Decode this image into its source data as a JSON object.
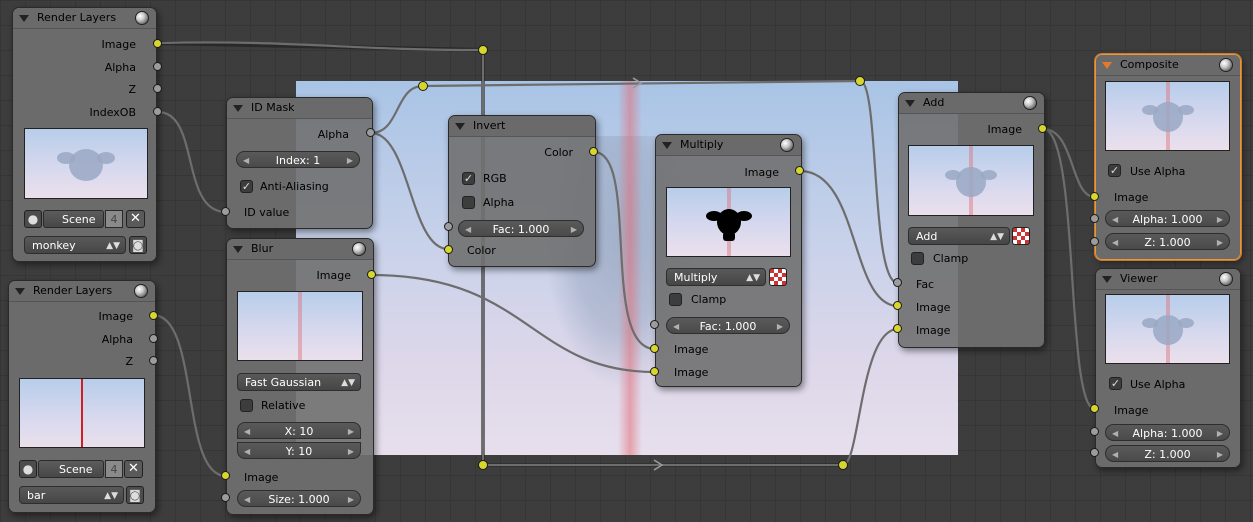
{
  "nodes": {
    "render_layers_1": {
      "title": "Render Layers",
      "outputs": [
        "Image",
        "Alpha",
        "Z",
        "IndexOB"
      ],
      "scene": "Scene",
      "scene_num": "4",
      "layer": "monkey"
    },
    "render_layers_2": {
      "title": "Render Layers",
      "outputs": [
        "Image",
        "Alpha",
        "Z"
      ],
      "scene": "Scene",
      "scene_num": "4",
      "layer": "bar"
    },
    "id_mask": {
      "title": "ID Mask",
      "output": "Alpha",
      "index": "Index: 1",
      "anti_aliasing": "Anti-Aliasing",
      "anti_aliasing_checked": true,
      "input": "ID value"
    },
    "blur": {
      "title": "Blur",
      "output": "Image",
      "filter": "Fast Gaussian",
      "relative": "Relative",
      "relative_checked": false,
      "x": "X: 10",
      "y": "Y: 10",
      "input": "Image",
      "size": "Size: 1.000"
    },
    "invert": {
      "title": "Invert",
      "output": "Color",
      "rgb": "RGB",
      "rgb_checked": true,
      "alpha": "Alpha",
      "alpha_checked": false,
      "fac": "Fac: 1.000",
      "input": "Color"
    },
    "multiply": {
      "title": "Multiply",
      "output": "Image",
      "blend": "Multiply",
      "clamp": "Clamp",
      "clamp_checked": false,
      "fac": "Fac: 1.000",
      "input1": "Image",
      "input2": "Image"
    },
    "add": {
      "title": "Add",
      "output": "Image",
      "blend": "Add",
      "clamp": "Clamp",
      "clamp_checked": false,
      "fac": "Fac",
      "input1": "Image",
      "input2": "Image"
    },
    "composite": {
      "title": "Composite",
      "use_alpha": "Use Alpha",
      "use_alpha_checked": true,
      "input": "Image",
      "alpha": "Alpha: 1.000",
      "z": "Z: 1.000"
    },
    "viewer": {
      "title": "Viewer",
      "use_alpha": "Use Alpha",
      "use_alpha_checked": true,
      "input": "Image",
      "alpha": "Alpha: 1.000",
      "z": "Z: 1.000"
    }
  },
  "icons": {
    "node_collapse": "triangle-down-icon",
    "node_preview_toggle": "sphere-icon",
    "scene_browse": "scene-icon",
    "scene_unlink": "x-icon",
    "render_layer": "camera-icon",
    "color_mix": "checker-icon"
  },
  "colors": {
    "socket_color": "#d6d62e",
    "socket_value": "#9c9c9c",
    "selected_node_border": "#e9953c",
    "wire": "#1a1a1a"
  }
}
